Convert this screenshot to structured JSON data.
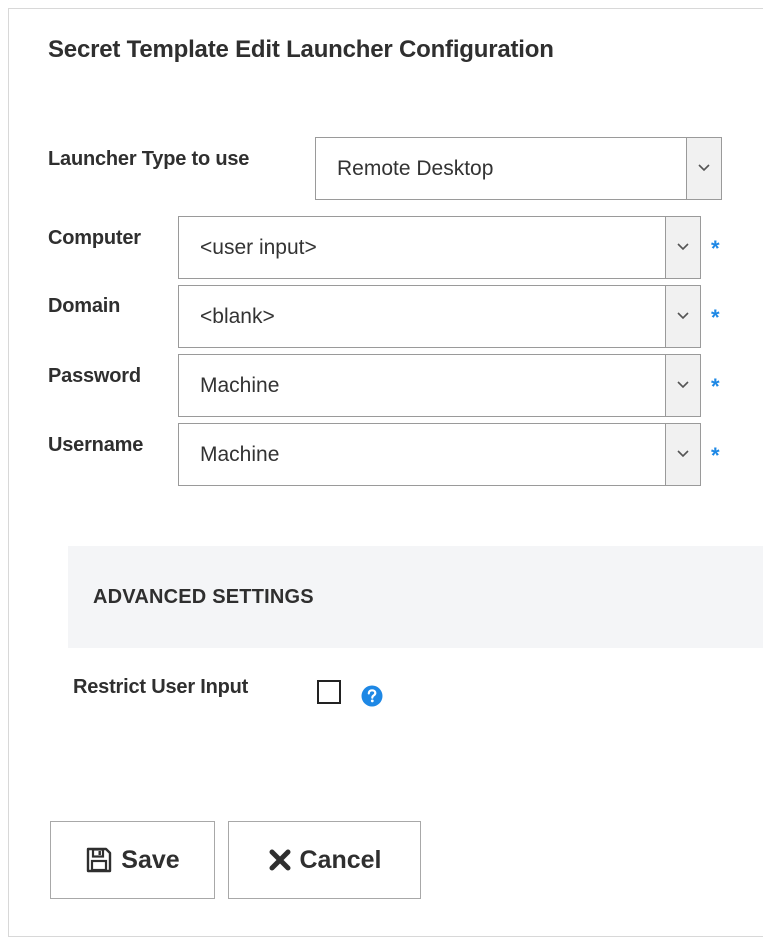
{
  "title": "Secret Template Edit Launcher Configuration",
  "launcher_type": {
    "label": "Launcher Type to use",
    "value": "Remote Desktop"
  },
  "fields": [
    {
      "label": "Computer",
      "value": "<user input>",
      "required": "*"
    },
    {
      "label": "Domain",
      "value": "<blank>",
      "required": "*"
    },
    {
      "label": "Password",
      "value": "Machine",
      "required": "*"
    },
    {
      "label": "Username",
      "value": "Machine",
      "required": "*"
    }
  ],
  "advanced": {
    "heading": "ADVANCED SETTINGS"
  },
  "restrict_user_input": {
    "label": "Restrict User Input",
    "checked": false
  },
  "buttons": {
    "save": "Save",
    "cancel": "Cancel"
  },
  "icons": {
    "dropdown": "chevron-down-icon",
    "help": "question-circle-icon",
    "save": "floppy-disk-icon",
    "cancel": "x-icon"
  },
  "colors": {
    "required_star": "#1e88e5",
    "help_icon": "#1e88e5",
    "advanced_bg": "#f4f5f7"
  }
}
